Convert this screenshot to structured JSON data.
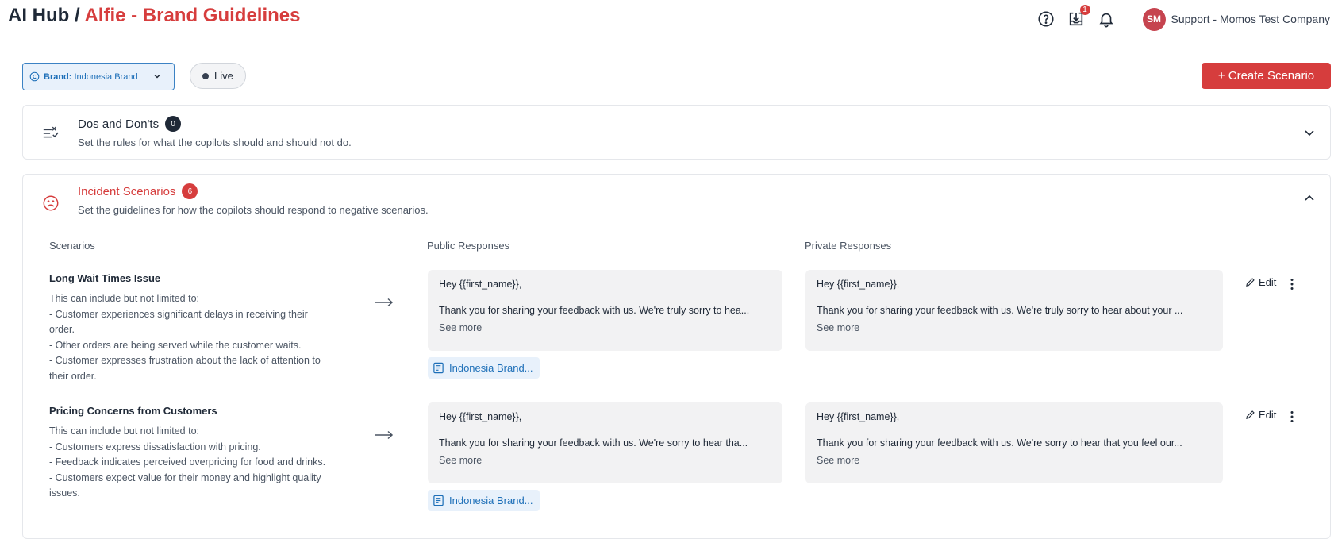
{
  "header": {
    "breadcrumb_root": "AI Hub",
    "breadcrumb_sep": "/",
    "breadcrumb_current": "Alfie - Brand Guidelines",
    "notification_count": "1",
    "avatar_initials": "SM",
    "org_name": "Support - Momos Test Company",
    "icons": [
      "help-icon",
      "download-inbox-icon",
      "bell-icon"
    ]
  },
  "toolbar": {
    "brand_label": "Brand:",
    "brand_value": "Indonesia Brand",
    "status_label": "Live",
    "create_label": "+ Create Scenario"
  },
  "dos_section": {
    "title": "Dos and Don'ts",
    "count": "0",
    "description": "Set the rules for what the copilots should and should not do.",
    "expanded": false
  },
  "incident_section": {
    "title": "Incident Scenarios",
    "count": "6",
    "description": "Set the guidelines for how the copilots should respond to negative scenarios.",
    "expanded": true,
    "columns": [
      "Scenarios",
      "Public Responses",
      "Private Responses"
    ],
    "rows": [
      {
        "title": "Long Wait Times Issue",
        "description": "This can include but not limited to:\n- Customer experiences significant delays in receiving their order.\n- Other orders are being served while the customer waits.\n- Customer expresses frustration about the lack of attention to their order.",
        "public_greeting": "Hey {{first_name}},",
        "public_body": "Thank you for sharing your feedback with us. We're truly sorry to hea...",
        "private_greeting": "Hey {{first_name}},",
        "private_body": "Thank you for sharing your feedback with us. We're truly sorry to hear about your ...",
        "see_more": "See more",
        "brand_tag": "Indonesia Brand...",
        "edit_label": "Edit"
      },
      {
        "title": "Pricing Concerns from Customers",
        "description": "This can include but not limited to:\n- Customers express dissatisfaction with pricing.\n- Feedback indicates perceived overpricing for food and drinks.\n- Customers expect value for their money and highlight quality issues.",
        "public_greeting": "Hey {{first_name}},",
        "public_body": "Thank you for sharing your feedback with us. We're sorry to hear tha...",
        "private_greeting": "Hey {{first_name}},",
        "private_body": "Thank you for sharing your feedback with us. We're sorry to hear that you feel our...",
        "see_more": "See more",
        "brand_tag": "Indonesia Brand...",
        "edit_label": "Edit"
      }
    ]
  },
  "colors": {
    "accent_red": "#d63d3d",
    "link_blue": "#1d6fb8",
    "response_bg": "#f2f2f3"
  }
}
